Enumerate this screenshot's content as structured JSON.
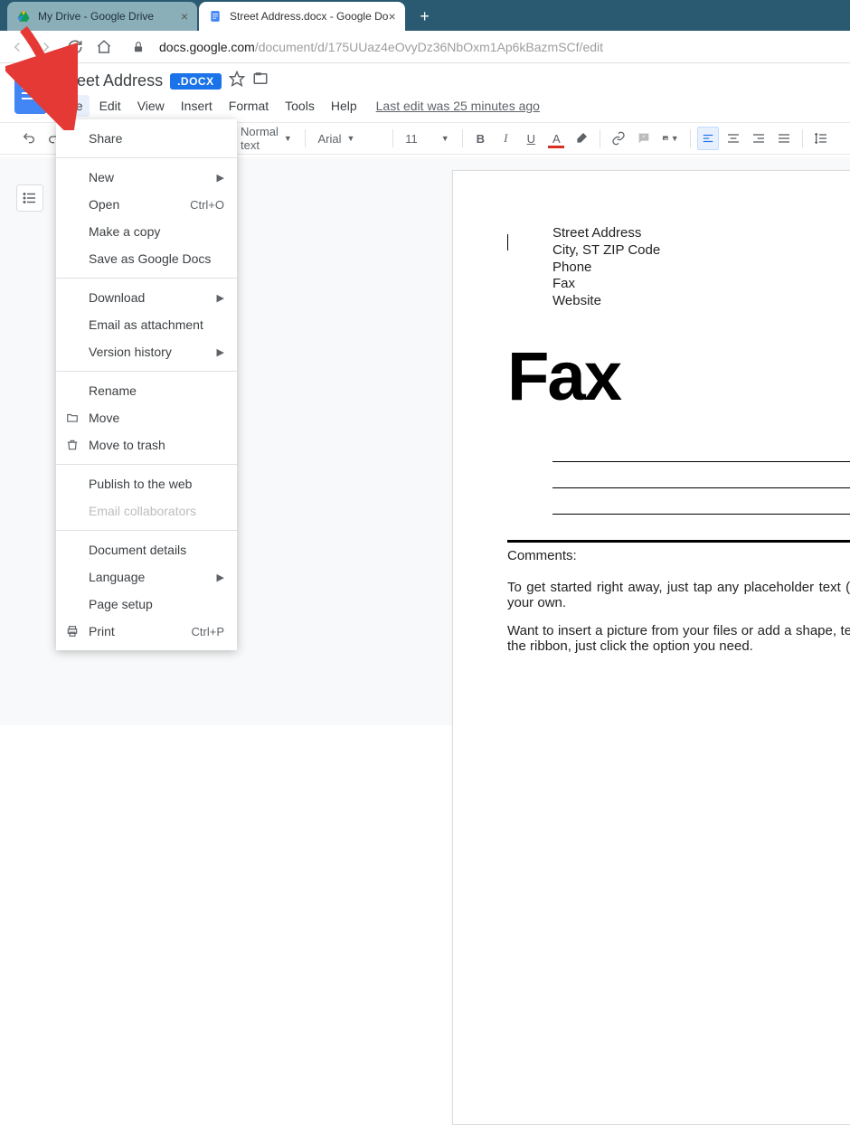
{
  "browser": {
    "tabs": [
      {
        "label": "My Drive - Google Drive",
        "active": false,
        "favicon": "drive"
      },
      {
        "label": "Street Address.docx - Google Do",
        "active": true,
        "favicon": "docs"
      }
    ],
    "url_host": "docs.google.com",
    "url_path": "/document/d/175UUaz4eOvyDz36NbOxm1Ap6kBazmSCf/edit"
  },
  "doc": {
    "title": "Street Address",
    "badge": ".DOCX",
    "last_edit": "Last edit was 25 minutes ago"
  },
  "menu": {
    "file": "File",
    "edit": "Edit",
    "view": "View",
    "insert": "Insert",
    "format": "Format",
    "tools": "Tools",
    "help": "Help"
  },
  "toolbar": {
    "style": "Normal text",
    "font": "Arial",
    "size": "11"
  },
  "file_menu": {
    "share": "Share",
    "new": "New",
    "open": "Open",
    "open_shortcut": "Ctrl+O",
    "make_copy": "Make a copy",
    "save_as": "Save as Google Docs",
    "download": "Download",
    "email_attachment": "Email as attachment",
    "version_history": "Version history",
    "rename": "Rename",
    "move": "Move",
    "move_trash": "Move to trash",
    "publish": "Publish to the web",
    "email_collab": "Email collaborators",
    "doc_details": "Document details",
    "language": "Language",
    "page_setup": "Page setup",
    "print": "Print",
    "print_shortcut": "Ctrl+P"
  },
  "page": {
    "addr1": "Street Address",
    "addr2": "City, ST ZIP Code",
    "addr3": "Phone",
    "addr4": "Fax",
    "addr5": "Website",
    "big_title": "Fax",
    "comments_label": "Comments:",
    "body1": "To get started right away, just tap any placeholder text (such as this) and start typing to replace it with your own.",
    "body2": "Want to insert a picture from your files or add a shape, text box, or table? You got it! On the Insert tab of the ribbon, just click the option you need."
  }
}
